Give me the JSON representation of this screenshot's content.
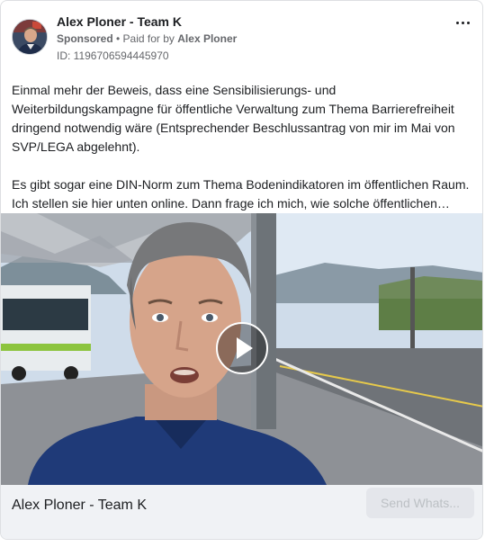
{
  "ad": {
    "page_name": "Alex Ploner - Team K",
    "sponsored_label": "Sponsored",
    "separator": " • ",
    "paid_for_by": "Paid for by",
    "advertiser": "Alex Ploner",
    "ad_id": "ID: 1196706594445970",
    "more_icon": "more-horizontal-icon"
  },
  "body": {
    "paragraph_1": "Einmal mehr der Beweis, dass eine Sensibilisierungs- und Weiterbildungskampagne für öffentliche Verwaltung zum Thema Barrierefreiheit dringend notwendig wäre (Entsprechender Beschlussantrag von mir im Mai von SVP/LEGA abgelehnt).",
    "paragraph_2": "Es gibt sogar eine DIN-Norm zum Thema Bodenindikatoren im öffentlichen Raum. Ich stellen sie hier unten online. Dann frage ich mich, wie solche öffentlichen…"
  },
  "media": {
    "type": "video",
    "play_icon": "play-icon"
  },
  "footer": {
    "page_name": "Alex Ploner - Team K",
    "cta_label": "Send Whats..."
  },
  "colors": {
    "text_primary": "#1c1e21",
    "text_secondary": "#65676b",
    "footer_bg": "#f0f2f5",
    "cta_bg": "#e4e6eb",
    "cta_text": "#bcc0c4"
  }
}
